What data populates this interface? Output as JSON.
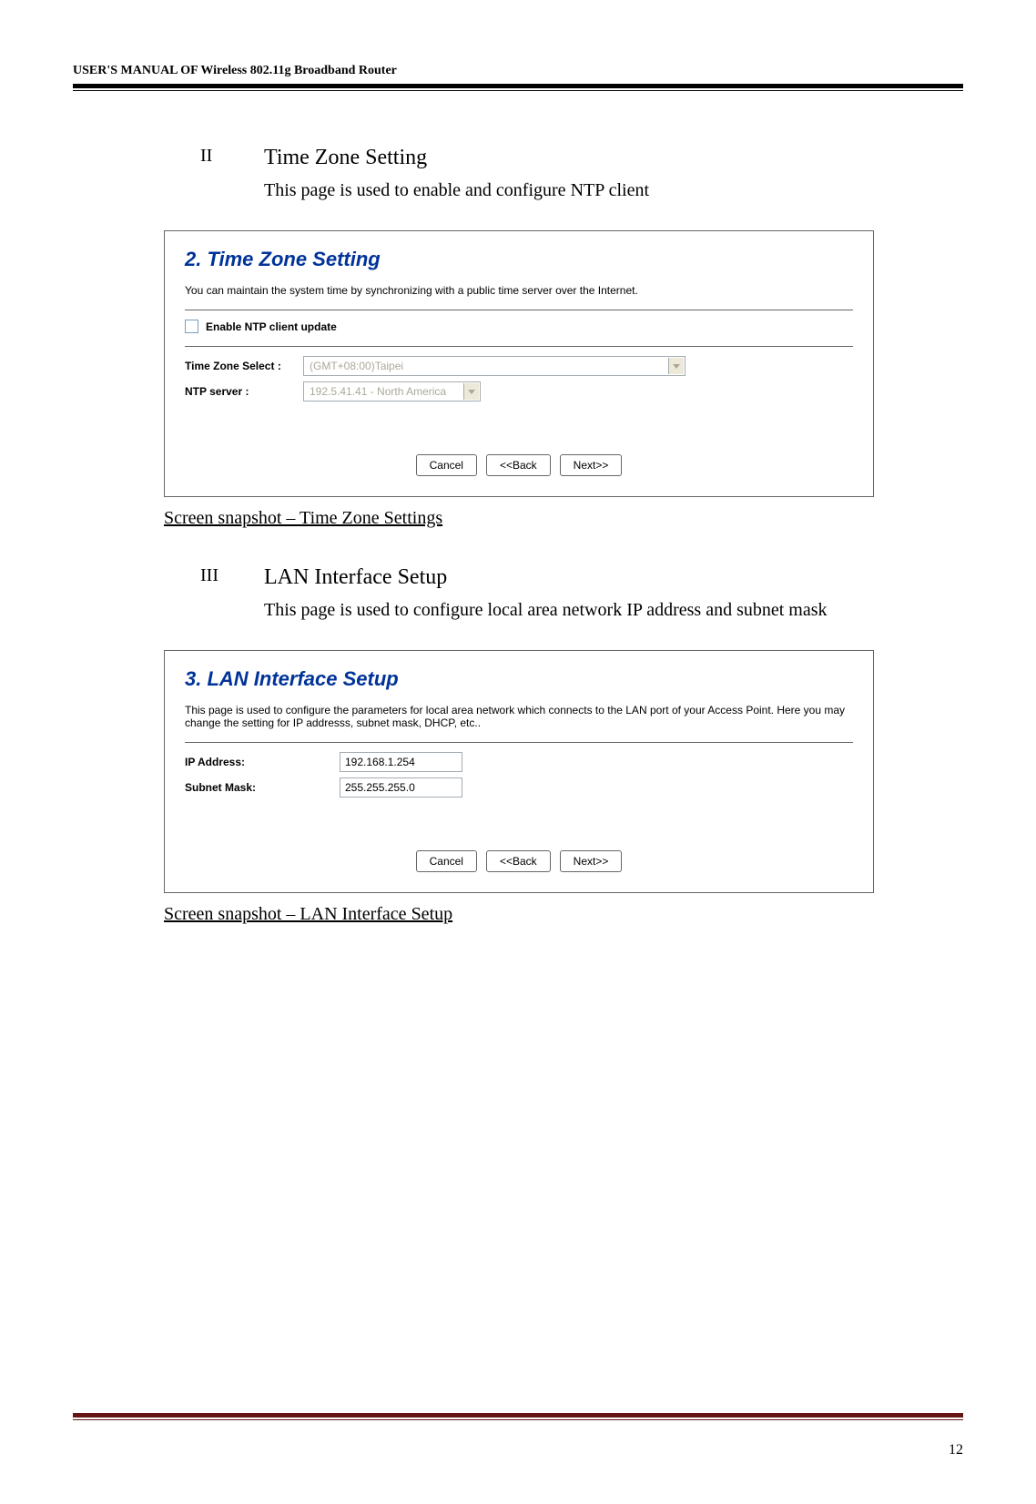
{
  "header": "USER'S MANUAL OF Wireless 802.11g Broadband Router",
  "sections": {
    "s2": {
      "roman": "II",
      "title": "Time Zone Setting",
      "desc": "This page is used to enable and configure NTP client"
    },
    "s3": {
      "roman": "III",
      "title": "LAN Interface Setup",
      "desc": "This page is used to configure local area network IP address and subnet mask"
    }
  },
  "panel_tz": {
    "title": "2. Time Zone Setting",
    "sub": "You can maintain the system time by synchronizing with a public time server over the Internet.",
    "check_label": "Enable NTP client update",
    "tz_label": "Time Zone Select :",
    "tz_value": "(GMT+08:00)Taipei",
    "ntp_label": "NTP server :",
    "ntp_value": "192.5.41.41 - North America",
    "buttons": {
      "cancel": "Cancel",
      "back": "<<Back",
      "next": "Next>>"
    }
  },
  "caption_tz": "Screen snapshot – Time Zone Settings",
  "panel_lan": {
    "title": "3. LAN Interface Setup",
    "sub": "This page is used to configure the parameters for local area network which connects to the LAN port of your Access Point. Here you may change the setting for IP addresss, subnet mask, DHCP, etc..",
    "ip_label": "IP Address:",
    "ip_value": "192.168.1.254",
    "mask_label": "Subnet Mask:",
    "mask_value": "255.255.255.0",
    "buttons": {
      "cancel": "Cancel",
      "back": "<<Back",
      "next": "Next>>"
    }
  },
  "caption_lan": "Screen snapshot – LAN Interface Setup",
  "page_number": "12"
}
